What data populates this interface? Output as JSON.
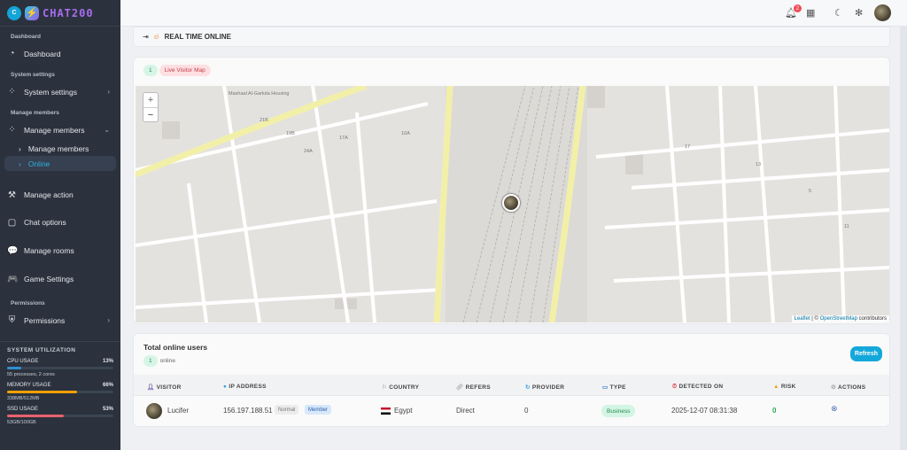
{
  "brand": {
    "initial": "C",
    "name": "CHAT200"
  },
  "sidebar": {
    "sections": [
      "Dashboard",
      "System settings",
      "Manage members",
      "Permissions"
    ],
    "items": {
      "dashboard": "Dashboard",
      "system": "System settings",
      "members": "Manage members",
      "members_sub": "Manage members",
      "online": "Online",
      "action": "Manage action",
      "chat": "Chat options",
      "rooms": "Manage rooms",
      "game": "Game Settings",
      "permissions": "Permissions"
    },
    "utilization": {
      "title": "SYSTEM UTILIZATION",
      "cpu": {
        "label": "CPU USAGE",
        "value": "13%",
        "pct": 13,
        "note": "55 processes, 2 cores",
        "color": "#2f8fd0"
      },
      "memory": {
        "label": "MEMORY USAGE",
        "value": "66%",
        "pct": 66,
        "note": "338MB/512MB",
        "color": "#f5a000"
      },
      "ssd": {
        "label": "SSD USAGE",
        "value": "53%",
        "pct": 53,
        "note": "53GB/100GB",
        "color": "#e9626e"
      }
    }
  },
  "topbar": {
    "notifications": "2"
  },
  "header": {
    "title": "REAL TIME ONLINE"
  },
  "map": {
    "count": "1",
    "label": "Live Visitor Map",
    "zoom_in": "+",
    "zoom_out": "−",
    "attribution_leaflet": "Leaflet",
    "attribution_sep": " | © ",
    "attribution_osm": "OpenStreetMap",
    "attribution_tail": " contributors",
    "place": "Mashaal Al-Garkda Housing"
  },
  "table": {
    "title": "Total online users",
    "count": "1",
    "count_label": "online",
    "refresh": "Refresh",
    "columns": [
      "VISITOR",
      "IP ADDRESS",
      "COUNTRY",
      "REFERS",
      "PROVIDER",
      "TYPE",
      "DETECTED ON",
      "RISK",
      "ACTIONS"
    ],
    "rows": [
      {
        "visitor": "Lucifer",
        "ip": "156.197.188.51",
        "tag1": "Normal",
        "tag2": "Member",
        "country": "Egypt",
        "refers": "Direct",
        "provider": "0",
        "type": "Business",
        "detected": "2025-12-07 08:31:38",
        "risk": "0"
      }
    ]
  }
}
